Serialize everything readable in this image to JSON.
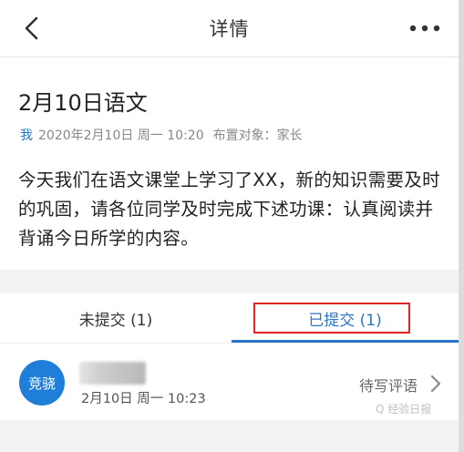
{
  "nav": {
    "title": "详情",
    "back_icon": "back-chevron-icon",
    "more_icon": "more-dots-icon"
  },
  "homework": {
    "title": "2月10日语文",
    "author": "我",
    "datetime": "2020年2月10日 周一 10:20",
    "target": "布置对象：家长",
    "content": "今天我们在语文课堂上学习了XX，新的知识需要及时的巩固，请各位同学及时完成下述功课：认真阅读并背诵今日所学的内容。"
  },
  "tabs": [
    {
      "label": "未提交 (1)",
      "active": false
    },
    {
      "label": "已提交 (1)",
      "active": true
    }
  ],
  "submissions": [
    {
      "avatar_text": "竞骁",
      "time": "2月10日 周一 10:23",
      "action": "待写评语"
    }
  ],
  "watermark": "Q 经验日报",
  "colors": {
    "accent": "#2b76c9",
    "avatar": "#1f7fd8",
    "highlight_box": "#e02424",
    "background": "#f2f2f2"
  }
}
